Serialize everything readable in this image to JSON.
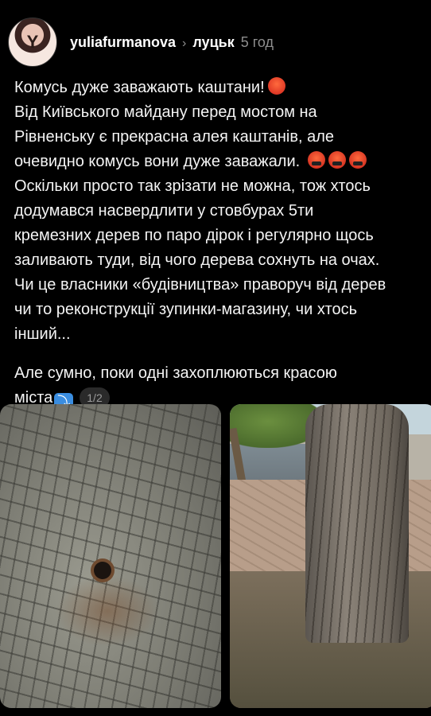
{
  "header": {
    "avatar_icon": "profile-avatar",
    "username": "yuliafurmanova",
    "chevron": "›",
    "location": "луцьк",
    "time": "5 год"
  },
  "post": {
    "paragraph1_lines": [
      "Комусь дуже заважають каштани!",
      "Від Київського майдану перед мостом на",
      "Рівненську є прекрасна алея каштанів, але",
      "очевидно комусь вони дуже заважали.",
      "Оскільки просто так зрізати не можна, тож хтось",
      "додумався насвердлити у стовбурах 5ти",
      "кремезних дерев по паро дірок і регулярно щось",
      "заливають туди, від чого дерева сохнуть на очах.",
      "Чи це власники «будівництва» праворуч від дерев",
      "чи то реконструкції зупинки-магазину, чи хтось",
      "інший..."
    ],
    "paragraph2_lines": [
      "Але сумно, поки одні захоплюються красою",
      "міста"
    ],
    "arrow_emoji": "⤵",
    "image_counter": "1/2",
    "emoji_angry": "angry-face",
    "emoji_cursing": "face-with-symbols-on-mouth"
  },
  "photos": [
    {
      "icon": "tree-bark-with-drilled-hole"
    },
    {
      "icon": "chestnut-tree-trunk-street"
    }
  ]
}
